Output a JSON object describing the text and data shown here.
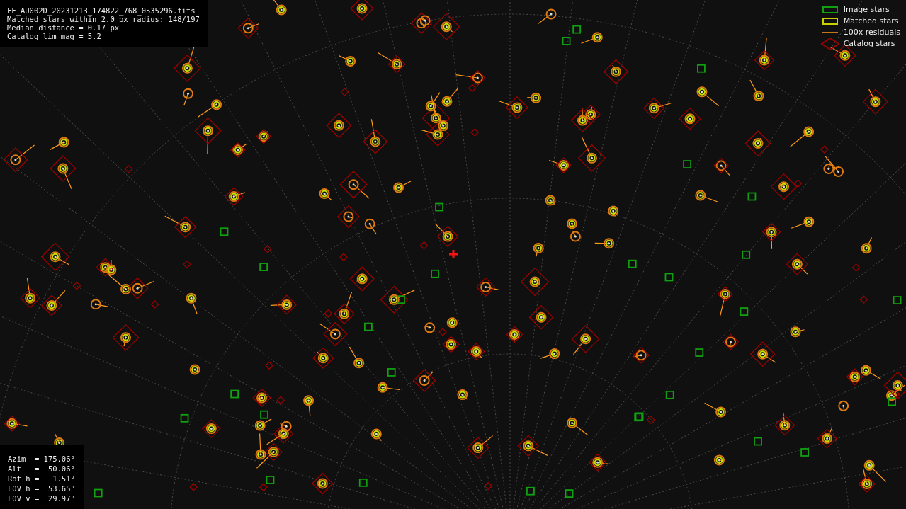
{
  "file_info": {
    "lines": [
      "FF_AU002D_20231213_174822_768_0535296.fits",
      "Matched stars within 2.0 px radius: 148/197",
      "Median distance = 0.17 px",
      "Catalog lim mag = 5.2"
    ]
  },
  "legend": {
    "items": [
      {
        "kind": "image",
        "label": "Image stars"
      },
      {
        "kind": "matched",
        "label": "Matched stars"
      },
      {
        "kind": "residual",
        "label": "100x residuals"
      },
      {
        "kind": "catalog",
        "label": "Catalog stars"
      }
    ]
  },
  "pointing": {
    "lines": [
      "Azim  = 175.06°",
      "Alt   =  50.06°",
      "Rot h =   1.51°",
      "FOV h =  53.65°",
      "FOV v =  29.97°"
    ]
  }
}
